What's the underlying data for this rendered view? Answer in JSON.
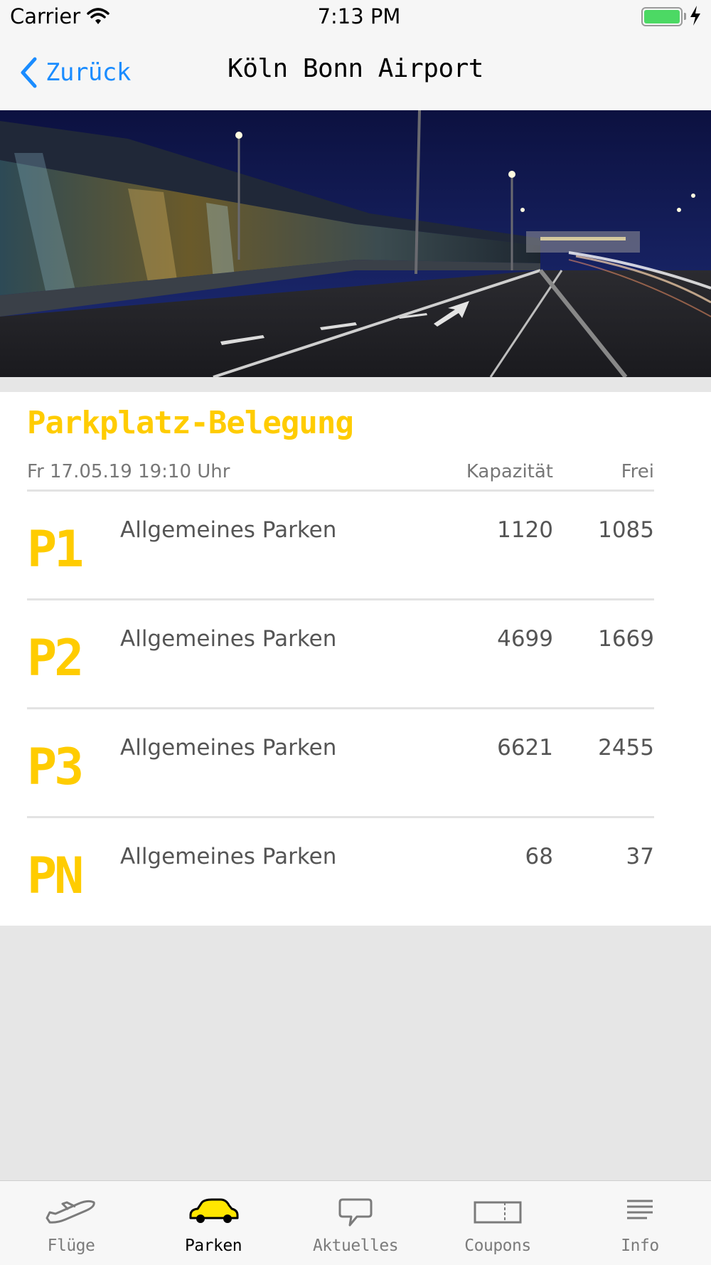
{
  "status": {
    "carrier": "Carrier",
    "time": "7:13 PM"
  },
  "nav": {
    "back_label": "Zurück",
    "title": "Köln Bonn Airport"
  },
  "section": {
    "title": "Parkplatz-Belegung",
    "timestamp": "Fr 17.05.19 19:10 Uhr",
    "col_capacity": "Kapazität",
    "col_free": "Frei"
  },
  "rows": [
    {
      "code": "P1",
      "name": "Allgemeines Parken",
      "capacity": "1120",
      "free": "1085"
    },
    {
      "code": "P2",
      "name": "Allgemeines Parken",
      "capacity": "4699",
      "free": "1669"
    },
    {
      "code": "P3",
      "name": "Allgemeines Parken",
      "capacity": "6621",
      "free": "2455"
    },
    {
      "code": "PN",
      "name": "Allgemeines Parken",
      "capacity": "68",
      "free": "37"
    }
  ],
  "tabs": [
    {
      "label": "Flüge",
      "icon": "airplane-icon",
      "active": false
    },
    {
      "label": "Parken",
      "icon": "car-icon",
      "active": true
    },
    {
      "label": "Aktuelles",
      "icon": "speech-bubble-icon",
      "active": false
    },
    {
      "label": "Coupons",
      "icon": "ticket-icon",
      "active": false
    },
    {
      "label": "Info",
      "icon": "list-icon",
      "active": false
    }
  ],
  "colors": {
    "accent": "#ffcc00",
    "link": "#1a8cff",
    "battery": "#4cd964"
  }
}
